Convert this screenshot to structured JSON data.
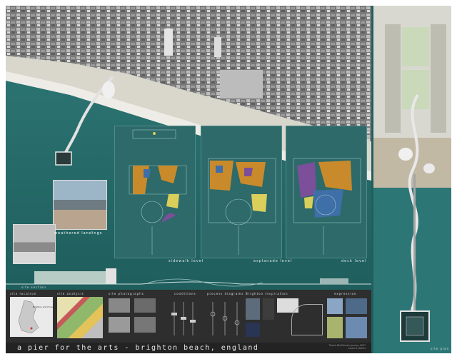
{
  "title": "a pier for the arts - brighton beach, england",
  "plan_labels": {
    "sidewalk": "sidewalk level",
    "esplanade": "esplanade level",
    "deck": "deck level"
  },
  "vignette_label": "weathered landings",
  "site_section": "site section",
  "site_plan": "site plan",
  "strip_titles": [
    "site location",
    "site analysis",
    "site photographs",
    "conditions",
    "process diagrams",
    "Brighton inspiration",
    "expression"
  ],
  "site_location_note": "Brighton and Hove",
  "credit": {
    "line1": "Thesis Mid-Review  January 2007",
    "line2": "Laura A. Albers"
  },
  "colors": {
    "sea": "#1f5f5e",
    "panel_dark": "#2e2e2e",
    "plan_orange": "#c98a2b",
    "plan_blue": "#3f6fa8",
    "plan_yellow": "#d9cf5a",
    "plan_purple": "#7b4f99"
  }
}
